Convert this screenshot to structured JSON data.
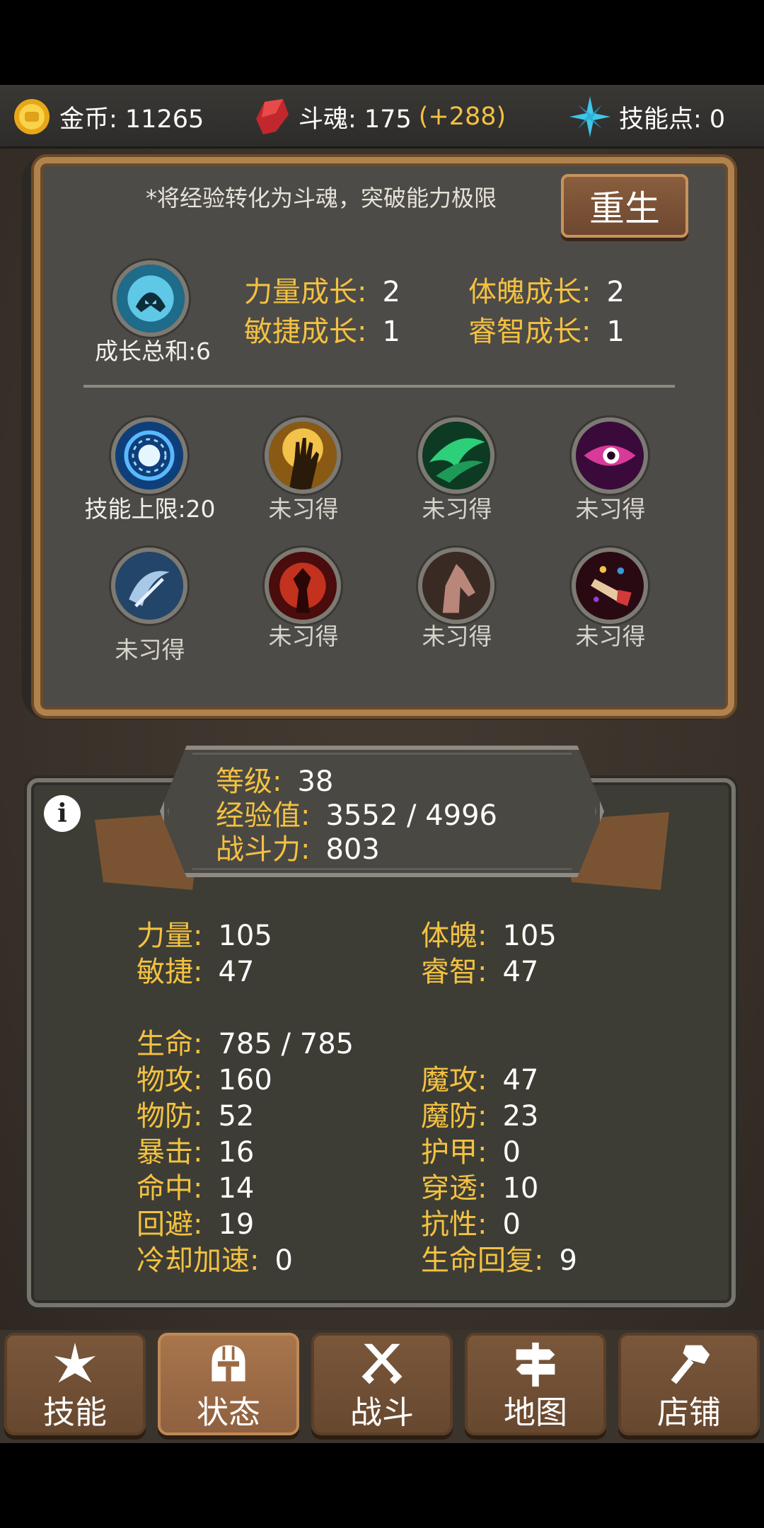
{
  "resources": {
    "gold_label": "金币: 11265",
    "soul_label": "斗魂: 175",
    "soul_bonus": "(+288)",
    "skill_points_label": "技能点: 0"
  },
  "rebirth": {
    "hint": "*将经验转化为斗魂，突破能力极限",
    "button": "重生"
  },
  "growth": {
    "total_label": "成长总和:6",
    "items": [
      {
        "label": "力量成长:",
        "value": "2"
      },
      {
        "label": "体魄成长:",
        "value": "2"
      },
      {
        "label": "敏捷成长:",
        "value": "1"
      },
      {
        "label": "睿智成长:",
        "value": "1"
      }
    ]
  },
  "skills": {
    "limit_label": "技能上限:20",
    "slots": [
      {
        "icon": "hand-light-icon",
        "label": "未习得"
      },
      {
        "icon": "green-wind-icon",
        "label": "未习得"
      },
      {
        "icon": "purple-eye-icon",
        "label": "未习得"
      },
      {
        "icon": "blue-slash-icon",
        "label": "未习得"
      },
      {
        "icon": "fire-warrior-icon",
        "label": "未习得"
      },
      {
        "icon": "horse-head-icon",
        "label": "未习得"
      },
      {
        "icon": "horn-blast-icon",
        "label": "未习得"
      }
    ]
  },
  "profile": {
    "level_label": "等级:",
    "level": "38",
    "exp_label": "经验值:",
    "exp": "3552 / 4996",
    "power_label": "战斗力:",
    "power": "803"
  },
  "stats": {
    "strength": {
      "label": "力量:",
      "value": "105"
    },
    "physique": {
      "label": "体魄:",
      "value": "105"
    },
    "agility": {
      "label": "敏捷:",
      "value": "47"
    },
    "wisdom": {
      "label": "睿智:",
      "value": "47"
    },
    "hp": {
      "label": "生命:",
      "value": "785 / 785"
    },
    "phys_atk": {
      "label": "物攻:",
      "value": "160"
    },
    "mag_atk": {
      "label": "魔攻:",
      "value": "47"
    },
    "phys_def": {
      "label": "物防:",
      "value": "52"
    },
    "mag_def": {
      "label": "魔防:",
      "value": "23"
    },
    "crit": {
      "label": "暴击:",
      "value": "16"
    },
    "armor": {
      "label": "护甲:",
      "value": "0"
    },
    "hit": {
      "label": "命中:",
      "value": "14"
    },
    "penetration": {
      "label": "穿透:",
      "value": "10"
    },
    "dodge": {
      "label": "回避:",
      "value": "19"
    },
    "resistance": {
      "label": "抗性:",
      "value": "0"
    },
    "cdr": {
      "label": "冷却加速:",
      "value": "0"
    },
    "regen": {
      "label": "生命回复:",
      "value": "9"
    }
  },
  "nav": [
    {
      "label": "技能",
      "icon": "sparkle-icon"
    },
    {
      "label": "状态",
      "icon": "helmet-icon"
    },
    {
      "label": "战斗",
      "icon": "crossed-swords-icon"
    },
    {
      "label": "地图",
      "icon": "signpost-icon"
    },
    {
      "label": "店铺",
      "icon": "hammer-icon"
    }
  ],
  "colors": {
    "accent_gold": "#f3c142",
    "panel_frame": "#b0824d",
    "nav_active": "#a8754c"
  }
}
